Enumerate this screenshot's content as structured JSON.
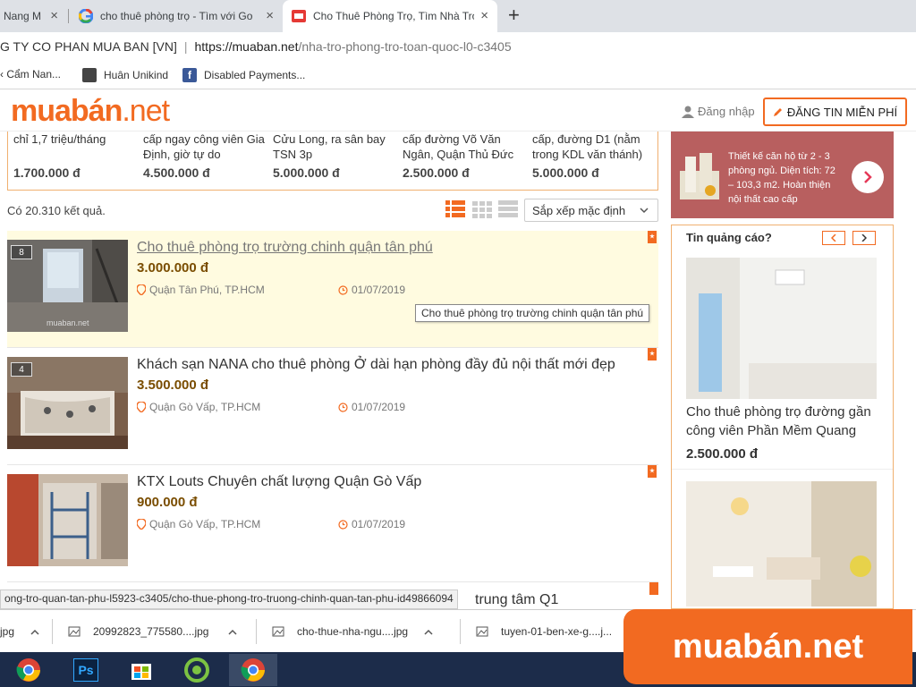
{
  "browser": {
    "tabs": [
      {
        "title": "Nang M",
        "active": false
      },
      {
        "title": "cho thuê phòng trọ - Tìm với Go",
        "active": false
      },
      {
        "title": "Cho Thuê Phòng Trọ, Tìm Nhà Trọ",
        "active": true
      }
    ],
    "new_tab": "+",
    "close": "×",
    "site_identity": "G TY CO PHAN MUA BAN [VN]",
    "url_sep": "|",
    "url_host": "https://muaban.net",
    "url_path": "/nha-tro-phong-tro-toan-quoc-l0-c3405",
    "bookmarks": [
      {
        "label": "‹ Cẩm Nan..."
      },
      {
        "label": "Huân Unikind"
      },
      {
        "label": "Disabled Payments..."
      }
    ]
  },
  "site": {
    "logo_main": "muabán",
    "logo_suffix": ".net",
    "login_label": "Đăng nhập",
    "post_button": "ĐĂNG TIN MIỄN PHÍ"
  },
  "featured": [
    {
      "desc": "chỉ 1,7 triệu/tháng",
      "price": "1.700.000 đ"
    },
    {
      "desc": "cấp ngay công viên Gia Định, giờ tự do",
      "price": "4.500.000 đ"
    },
    {
      "desc": "Cửu Long, ra sân bay TSN 3p",
      "price": "5.000.000 đ"
    },
    {
      "desc": "cấp đường Võ Văn Ngân, Quận Thủ Đức",
      "price": "2.500.000 đ"
    },
    {
      "desc": "cấp, đường D1 (nằm trong KDL văn thánh)",
      "price": "5.000.000 đ"
    }
  ],
  "results": {
    "count_text": "Có 20.310 kết quả.",
    "sort_label": "Sắp xếp mặc định"
  },
  "listings": [
    {
      "title": "Cho thuê phòng trọ trường chinh quận tân phú",
      "price": "3.000.000 đ",
      "location": "Quận Tân Phú, TP.HCM",
      "date": "01/07/2019",
      "photos": "8"
    },
    {
      "title": "Khách sạn NANA cho thuê phòng Ở dài hạn phòng đầy đủ nội thất mới đẹp",
      "price": "3.500.000 đ",
      "location": "Quận Gò Vấp, TP.HCM",
      "date": "01/07/2019",
      "photos": "4"
    },
    {
      "title": "KTX Louts Chuyên chất lượng Quận Gò Vấp",
      "price": "900.000 đ",
      "location": "Quận Gò Vấp, TP.HCM",
      "date": "01/07/2019",
      "photos": ""
    }
  ],
  "listing_partial": "trung tâm Q1",
  "tooltip": "Cho thuê phòng trọ trường chinh quận tân phú",
  "thumb_watermark": "muaban.net",
  "sidebar": {
    "banner_text": "Thiết kế căn hộ từ 2 - 3 phòng ngủ. Diện tích: 72 – 103,3 m2. Hoàn thiện nội thất cao cấp",
    "ads_title": "Tin quảng cáo?",
    "ad_title": "Cho thuê phòng trọ đường gần công viên Phần Mềm Quang",
    "ad_price": "2.500.000 đ"
  },
  "status_url": "ong-tro-quan-tan-phu-l5923-c3405/cho-thue-phong-tro-truong-chinh-quan-tan-phu-id49866094",
  "downloads": [
    {
      "name": "jpg"
    },
    {
      "name": "20992823_775580....jpg"
    },
    {
      "name": "cho-thue-nha-ngu....jpg"
    },
    {
      "name": "tuyen-01-ben-xe-g....j..."
    }
  ],
  "watermark": "muabán.net",
  "colors": {
    "brand": "#f26a21",
    "price": "#7a4d00",
    "highlight": "#fffbe0",
    "taskbar": "#1c2c4a"
  }
}
